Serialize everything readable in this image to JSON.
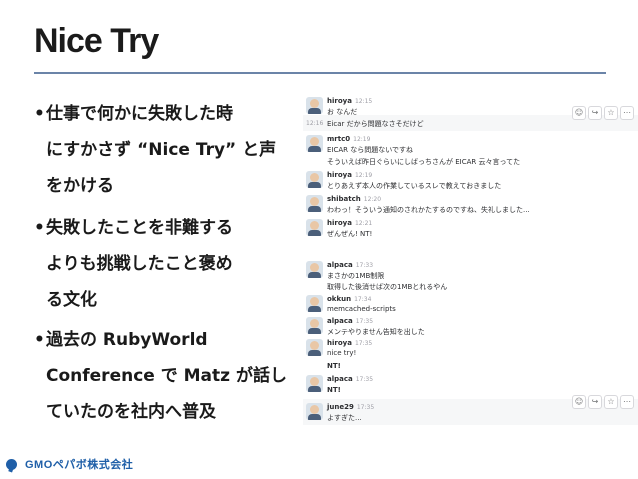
{
  "slide": {
    "title": "Nice Try",
    "bullets": [
      {
        "dot": "•",
        "lines": [
          "仕事で何かに失敗した時",
          "にすかさず “Nice Try” と声",
          "をかける"
        ]
      },
      {
        "dot": "•",
        "lines": [
          "失敗したことを非難する",
          "よりも挑戦したこと褒め",
          "る文化"
        ]
      },
      {
        "dot": "•",
        "lines": [
          "過去の RubyWorld",
          "Conference で Matz が話し",
          "ていたのを社内へ普及"
        ]
      }
    ],
    "footer_logo": "GMOペパボ株式会社"
  },
  "chat": {
    "messages": [
      {
        "name": "hiroya",
        "time": "12:15",
        "lines": [
          "お なんだ"
        ],
        "highlight": false
      },
      {
        "name": "",
        "time": "12:16",
        "lines": [
          "Eicar だから問題なさそだけど"
        ],
        "highlight": true,
        "actions": [
          "☺",
          "↪",
          "☆",
          "⋯"
        ]
      },
      {
        "name": "mrtc0",
        "time": "12:19",
        "lines": [
          "EICAR なら問題ないですね",
          "そういえば昨日ぐらいにしばっちさんが EICAR 云々言ってた"
        ],
        "highlight": false
      },
      {
        "name": "hiroya",
        "time": "12:19",
        "lines": [
          "とりあえず本人の作業しているスレで教えておきました"
        ],
        "highlight": false
      },
      {
        "name": "shibatch",
        "time": "12:20",
        "lines": [
          "わわっ！そういう通知のされかたするのですね、失礼しました..."
        ],
        "highlight": false
      },
      {
        "name": "hiroya",
        "time": "12:21",
        "lines": [
          "ぜんぜん! NT!"
        ],
        "highlight": false
      },
      {
        "name": "alpaca",
        "time": "17:33",
        "lines": [
          "まさかの1MB制限",
          "取得した後消せば次の1MBとれるやん"
        ],
        "highlight": false
      },
      {
        "name": "okkun",
        "time": "17:34",
        "lines": [
          "memcached-scripts"
        ],
        "highlight": false
      },
      {
        "name": "alpaca",
        "time": "17:35",
        "lines": [
          "メンテやりません告知を出した"
        ],
        "highlight": false
      },
      {
        "name": "hiroya",
        "time": "17:35",
        "lines": [
          "nice try!",
          "NT!"
        ],
        "highlight": false
      },
      {
        "name": "alpaca",
        "time": "17:35",
        "lines": [
          "NT!"
        ],
        "highlight": false
      },
      {
        "name": "june29",
        "time": "17:35",
        "lines": [
          "よすぎた..."
        ],
        "highlight": true,
        "actions": [
          "☺",
          "↪",
          "☆",
          "⋯"
        ]
      }
    ]
  }
}
